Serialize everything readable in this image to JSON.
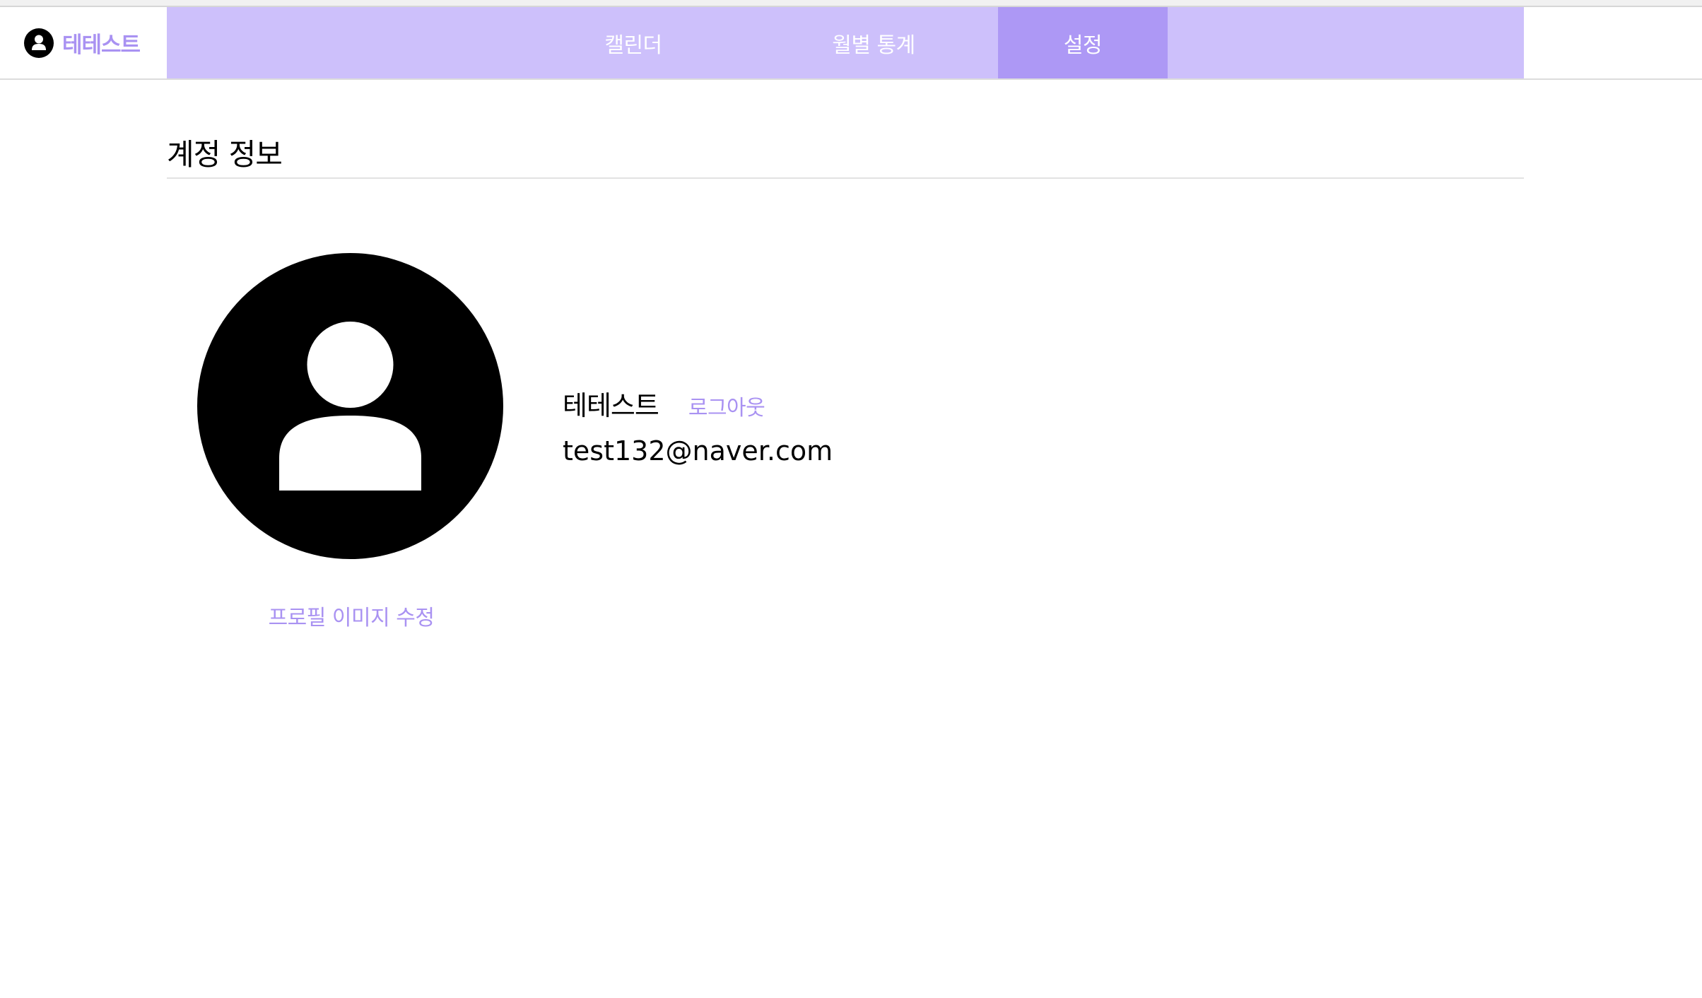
{
  "colors": {
    "nav_bg": "#cdc0fb",
    "nav_active": "#ad98f5",
    "accent_text": "#a992f2"
  },
  "brand": {
    "name": "테테스트",
    "icon": "user-circle-icon"
  },
  "nav": {
    "tabs": [
      {
        "label": "캘린더",
        "active": false
      },
      {
        "label": "월별 통계",
        "active": false
      },
      {
        "label": "설정",
        "active": true
      }
    ]
  },
  "account": {
    "section_title": "계정 정보",
    "avatar_icon": "user-avatar-icon",
    "edit_photo_label": "프로필 이미지 수정",
    "user_name": "테테스트",
    "logout_label": "로그아웃",
    "email": "test132@naver.com"
  }
}
